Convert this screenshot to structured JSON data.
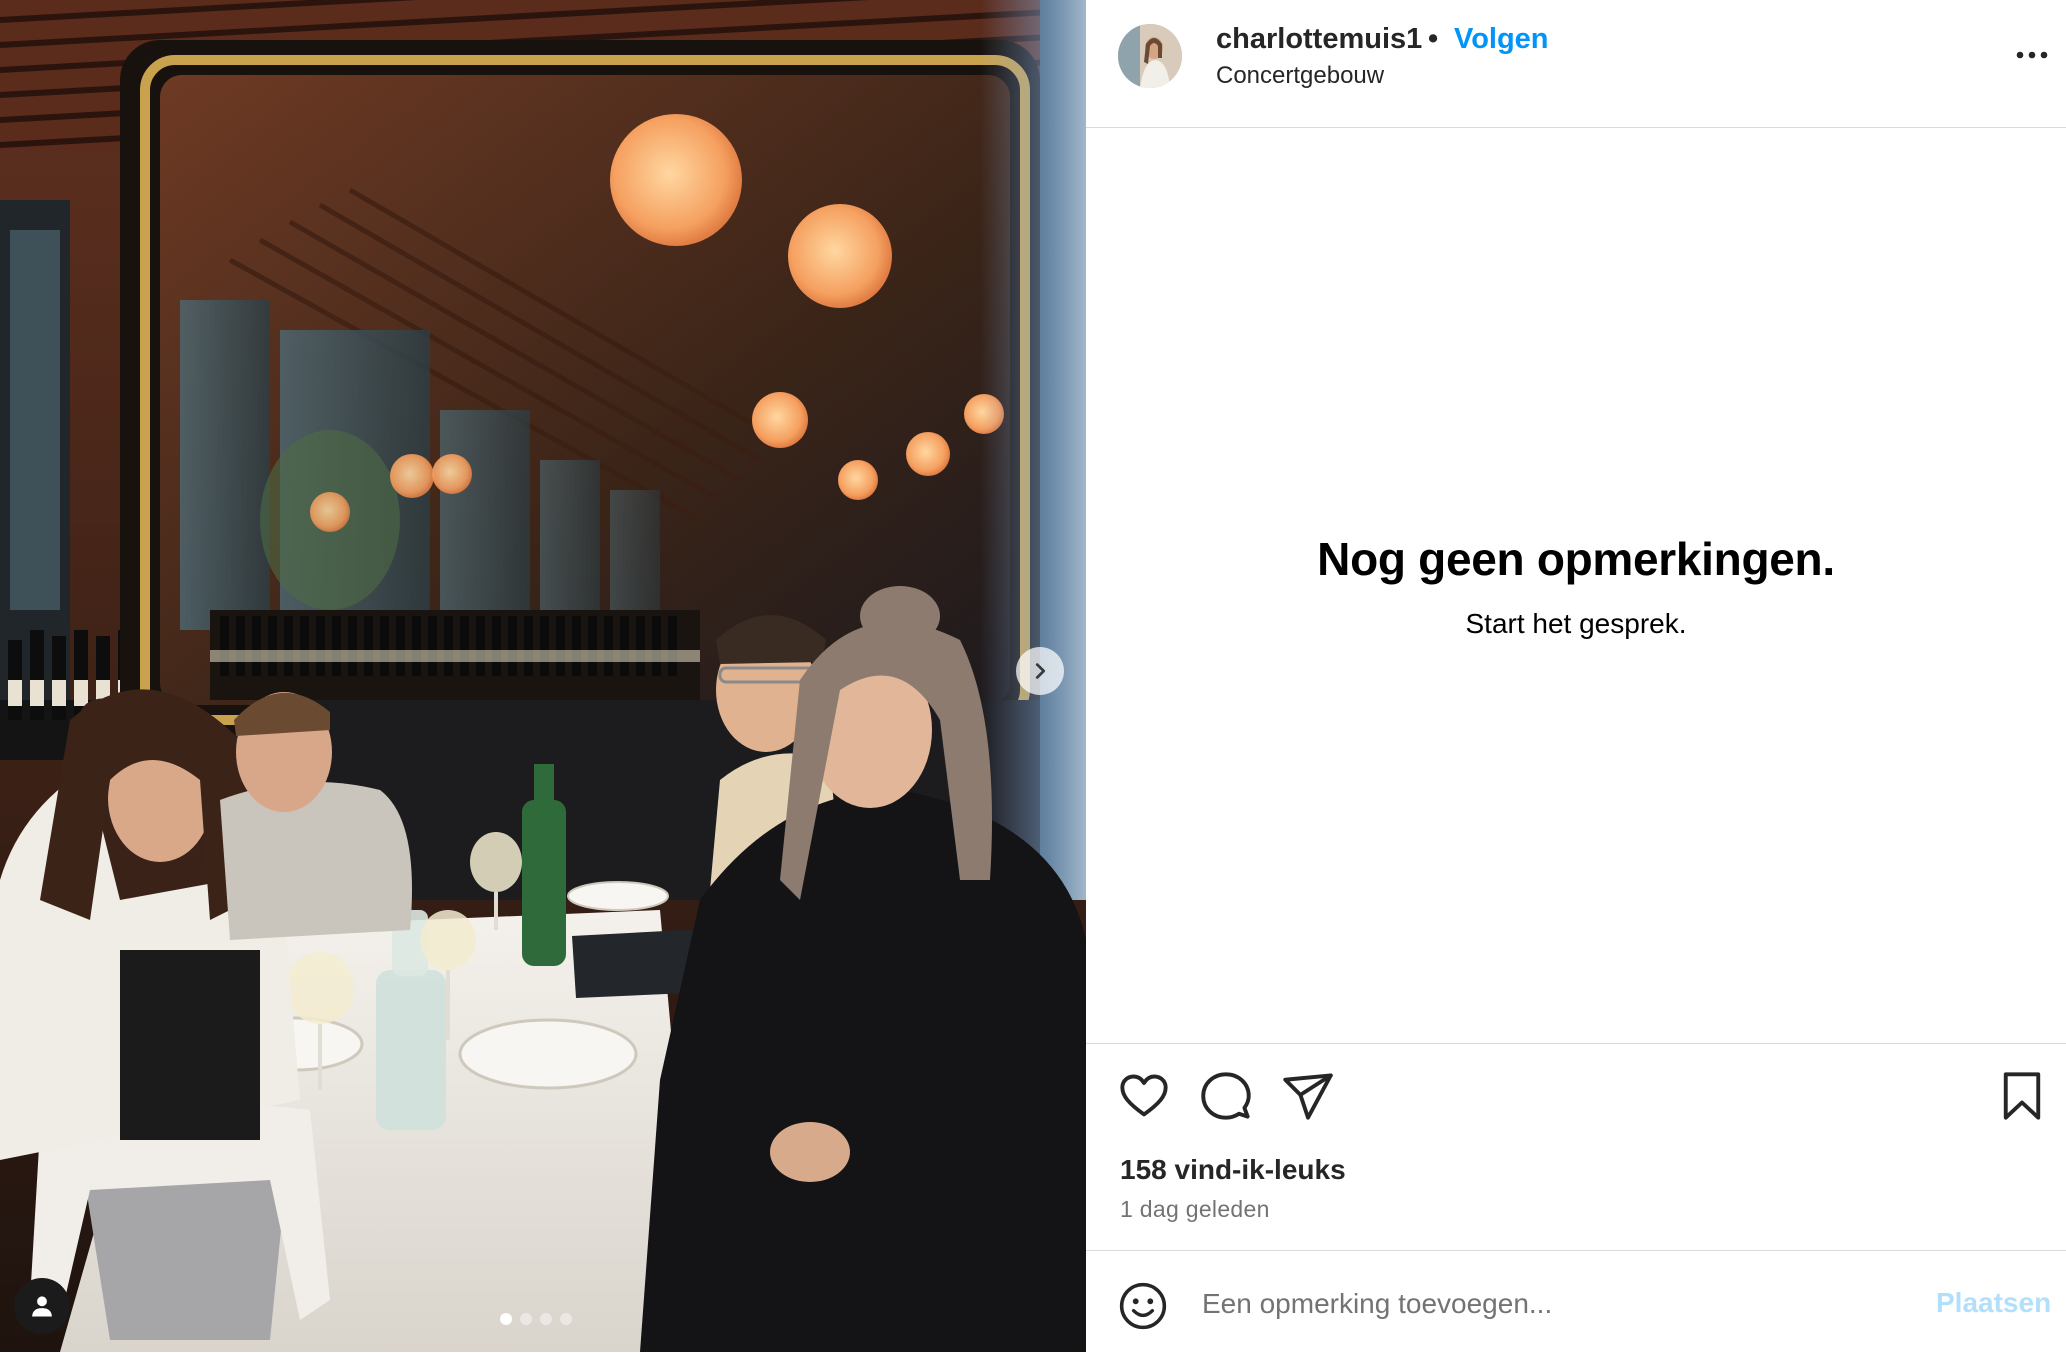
{
  "post": {
    "username": "charlottemuis1",
    "separator": "•",
    "follow_label": "Volgen",
    "location": "Concertgebouw",
    "more_icon": "more-horizontal-icon"
  },
  "comments": {
    "empty_title": "Nog geen opmerkingen.",
    "empty_subtitle": "Start het gesprek."
  },
  "actions": {
    "icons": [
      "heart-icon",
      "comment-icon",
      "share-icon",
      "bookmark-icon"
    ]
  },
  "stats": {
    "likes": "158 vind-ik-leuks",
    "time_ago": "1 dag geleden"
  },
  "comment_box": {
    "placeholder": "Een opmerking toevoegen...",
    "post_label": "Plaatsen"
  },
  "media": {
    "carousel_total": 4,
    "carousel_active": 1
  },
  "colors": {
    "link_blue": "#0095f6",
    "post_disabled": "#b2dffc",
    "border": "#dbdbdb",
    "secondary_text": "#737373"
  }
}
